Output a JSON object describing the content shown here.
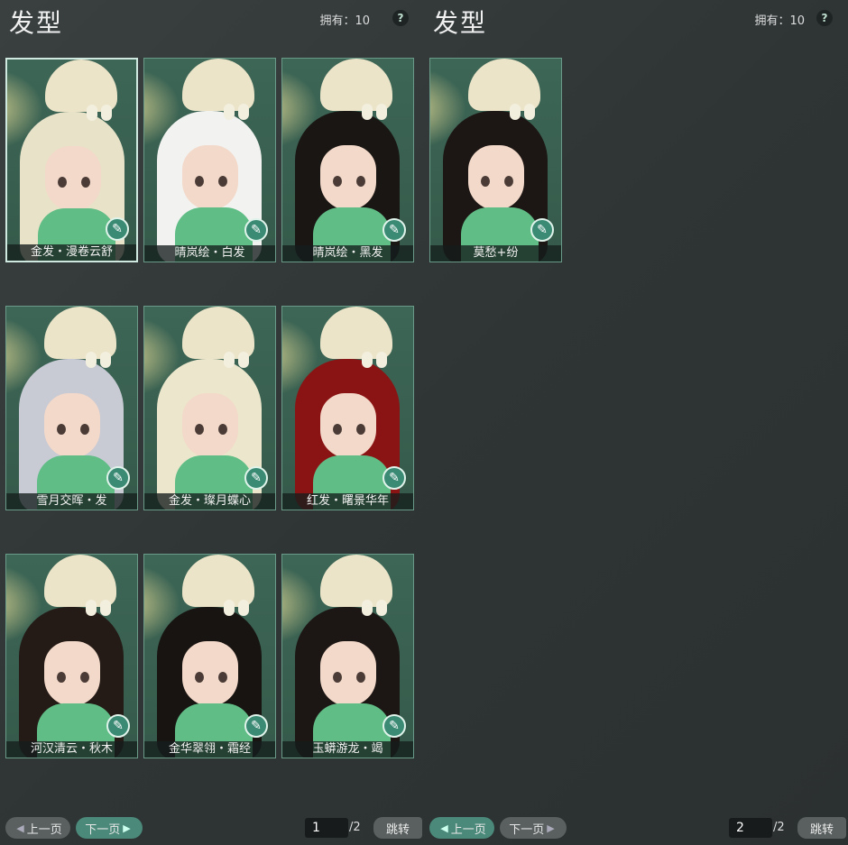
{
  "left_panel": {
    "title": "发型",
    "owned_label": "拥有：10",
    "help_label": "?",
    "cards": [
      {
        "name": "金发・漫卷云舒",
        "hair_color": "#e8e2c8"
      },
      {
        "name": "晴岚绘・白发",
        "hair_color": "#f2f2f0"
      },
      {
        "name": "晴岚绘・黑发",
        "hair_color": "#1a1614"
      },
      {
        "name": "雪月交晖・发",
        "hair_color": "#c8cad4"
      },
      {
        "name": "金发・璨月蝶心",
        "hair_color": "#ece6cc"
      },
      {
        "name": "红发・曙景华年",
        "hair_color": "#8a1414"
      },
      {
        "name": "河汉清云・秋木",
        "hair_color": "#241a16"
      },
      {
        "name": "金华翠翎・霜经",
        "hair_color": "#181412"
      },
      {
        "name": "玉蟒游龙・竭",
        "hair_color": "#1c1614"
      }
    ],
    "prev_label": "上一页",
    "next_label": "下一页",
    "page_current": "1",
    "page_total": "/2",
    "jump_label": "跳转"
  },
  "right_panel": {
    "title": "发型",
    "owned_label": "拥有：10",
    "help_label": "?",
    "cards": [
      {
        "name": "莫愁+纷",
        "hair_color": "#1c1614"
      }
    ],
    "prev_label": "上一页",
    "next_label": "下一页",
    "page_current": "2",
    "page_total": "/2",
    "jump_label": "跳转"
  }
}
